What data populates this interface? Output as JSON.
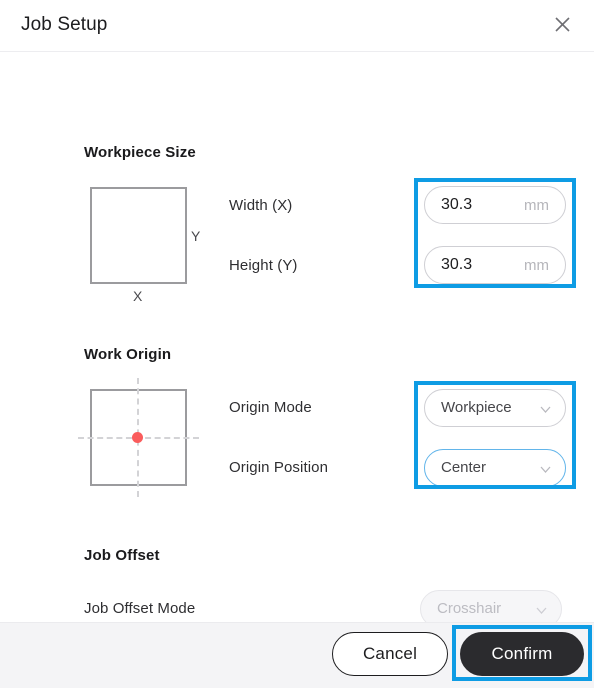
{
  "header": {
    "title": "Job Setup",
    "close_icon": "close-icon"
  },
  "sections": {
    "workpiece_size": {
      "title": "Workpiece Size",
      "diagram": {
        "x_label": "X",
        "y_label": "Y"
      },
      "fields": [
        {
          "label": "Width (X)",
          "value": "30.3",
          "unit": "mm"
        },
        {
          "label": "Height (Y)",
          "value": "30.3",
          "unit": "mm"
        }
      ]
    },
    "work_origin": {
      "title": "Work Origin",
      "diagram": {
        "dot_color": "#fa5c5c"
      },
      "fields": [
        {
          "label": "Origin Mode",
          "value": "Workpiece",
          "icon": "chevron-down-icon"
        },
        {
          "label": "Origin Position",
          "value": "Center",
          "icon": "chevron-down-icon"
        }
      ]
    },
    "job_offset": {
      "title": "Job Offset",
      "fields": [
        {
          "label": "Job Offset Mode",
          "value": "Crosshair",
          "icon": "chevron-down-icon"
        }
      ]
    }
  },
  "footer": {
    "cancel_label": "Cancel",
    "confirm_label": "Confirm"
  },
  "highlight_color": "#0e9ce4"
}
